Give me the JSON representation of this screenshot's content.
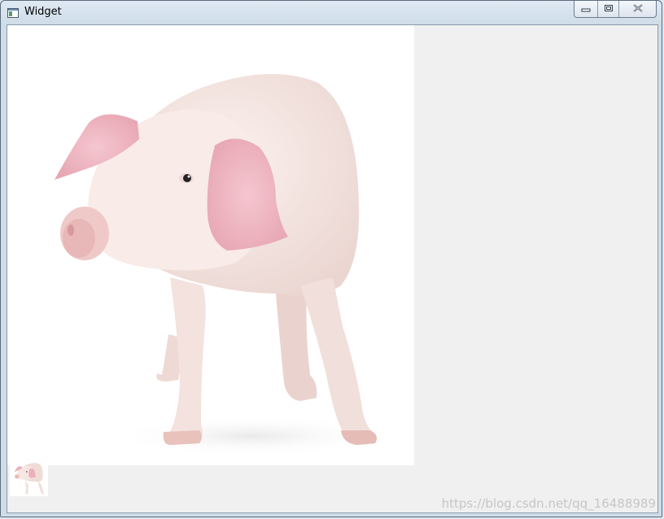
{
  "window": {
    "title": "Widget",
    "icon": "app-window-icon",
    "caption_buttons": [
      "minimize-icon",
      "maximize-icon",
      "close-icon"
    ]
  },
  "content": {
    "main_image": "pig-image",
    "thumbnail_image": "pig-thumbnail-image"
  },
  "watermark": {
    "text": "https://blog.csdn.net/qq_16488989"
  },
  "colors": {
    "client_background": "#f0f0f0",
    "image_background": "#ffffff",
    "pig_skin": "#f7e6e3",
    "pig_ear": "#eeb4bf"
  }
}
